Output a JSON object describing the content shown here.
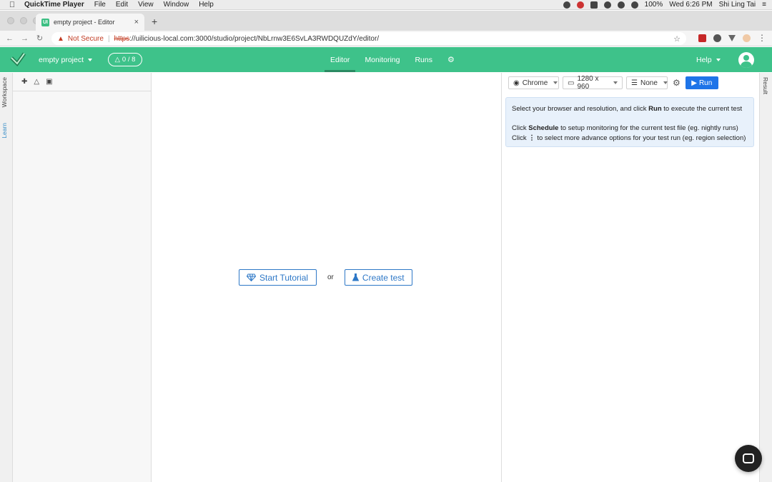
{
  "menubar": {
    "app_name": "QuickTime Player",
    "menus": [
      "File",
      "Edit",
      "View",
      "Window",
      "Help"
    ],
    "battery": "100%",
    "datetime": "Wed 6:26 PM",
    "user": "Shi Ling Tai"
  },
  "browser": {
    "tab_title": "empty project - Editor",
    "tab_favicon": "UI",
    "security_label": "Not Secure",
    "url_scheme": "https",
    "url_rest": "://uilicious-local.com:3000/studio/project/NbLrnw3E6SvLA3RWDQUZdY/editor/"
  },
  "header": {
    "project_name": "empty project",
    "test_count": "0 / 8",
    "nav": [
      "Editor",
      "Monitoring",
      "Runs"
    ],
    "active_nav": "Editor",
    "help_label": "Help",
    "accent_color": "#3ec28a"
  },
  "siderail": {
    "workspace_label": "Workspace",
    "learn_label": "Learn"
  },
  "editor": {
    "tutorial_button": "Start Tutorial",
    "or_label": "or",
    "create_button": "Create test"
  },
  "runpanel": {
    "browser": "Chrome",
    "resolution": "1280 x 960",
    "data_option": "None",
    "run_label": "Run",
    "info_line1_a": "Select your browser and resolution, and click ",
    "info_line1_b": "Run",
    "info_line1_c": " to execute the current test",
    "info_line2_a": "Click ",
    "info_line2_b": "Schedule",
    "info_line2_c": " to setup monitoring for the current test file (eg. nightly runs)",
    "info_line3_a": "Click ",
    "info_line3_b": "⋮",
    "info_line3_c": " to select more advance options for your test run (eg. region selection)"
  },
  "rightrail": {
    "result_label": "Result"
  },
  "icons": {
    "apple": "apple-icon",
    "flask": "flask-icon",
    "gem": "gem-icon",
    "gear": "gear-icon",
    "chat": "chat-icon"
  }
}
